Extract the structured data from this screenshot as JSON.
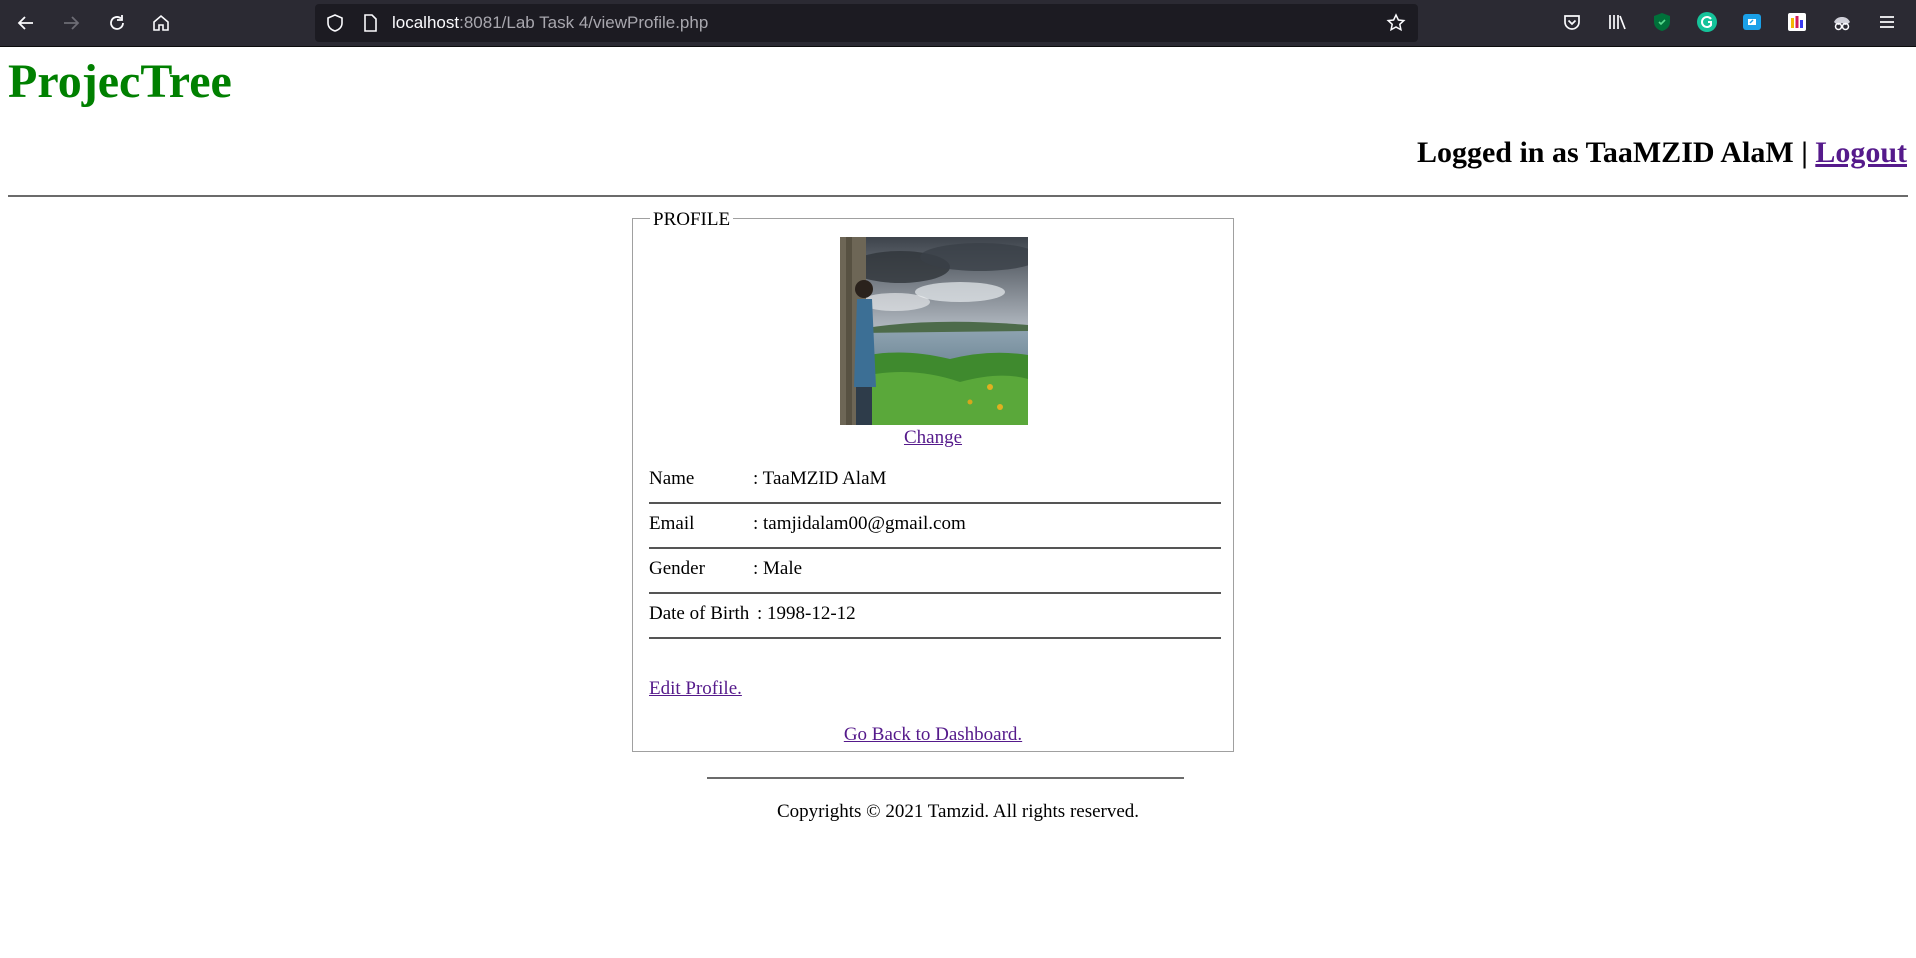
{
  "browser": {
    "url_host": "localhost",
    "url_rest": ":8081/Lab Task 4/viewProfile.php",
    "colors": {
      "toolbar": "#2b2a33",
      "urlbar": "#1c1b22"
    }
  },
  "site": {
    "logo": "ProjecTree",
    "logged_in_text": "Logged in as TaaMZID AlaM | ",
    "logout_label": "Logout",
    "logo_color": "#008000",
    "link_color": "#551a8b"
  },
  "profile": {
    "legend": "PROFILE",
    "change_label": "Change",
    "fields": [
      {
        "label": "Name",
        "value": ": TaaMZID AlaM"
      },
      {
        "label": "Email",
        "value": ": tamjidalam00@gmail.com"
      },
      {
        "label": "Gender",
        "value": ": Male"
      },
      {
        "label": "Date of Birth",
        "value": ": 1998-12-12"
      }
    ],
    "edit_label": "Edit Profile.",
    "back_label": "Go Back to Dashboard."
  },
  "footer": {
    "copyright": "Copyrights © 2021 Tamzid. All rights reserved."
  }
}
